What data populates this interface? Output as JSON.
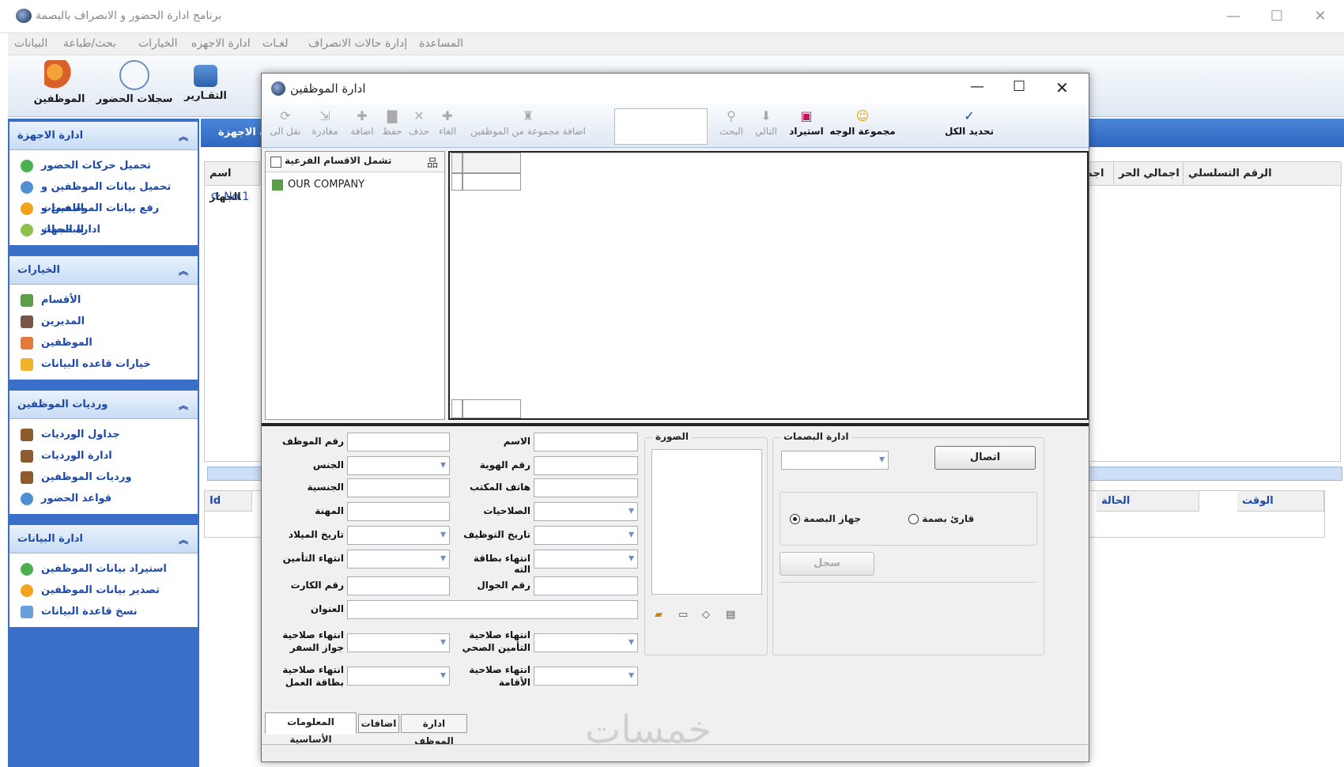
{
  "app": {
    "title": "برنامج ادارة الحضور و الانصراف بالبصمة"
  },
  "menu": [
    "البيانات",
    "بحث/طباعة",
    "الخيارات",
    "ادارة الاجهزه",
    "لغـات",
    "إدارة حالات الانصراف",
    "المساعدة"
  ],
  "toolbar": {
    "employees": "الموظفين",
    "attendance_log": "سجلات الحضور",
    "reports": "التقـارير"
  },
  "sidebar": {
    "devices": {
      "title": "ادارة الاجهزة",
      "items": [
        "تحميل حركات الحضور",
        "تحميل بيانات الموظفين و البصمات",
        "رفع بيانات الموظفين و البصمات",
        "ادارة الجهاز"
      ]
    },
    "options": {
      "title": "الخيارات",
      "items": [
        "الأقسام",
        "المديرين",
        "الموظفين",
        "خيارات قاعده البيانات"
      ]
    },
    "shifts": {
      "title": "ورديات الموظفين",
      "items": [
        "جداول الورديات",
        "ادارة الورديات",
        "ورديات الموظفين",
        "قواعد الحضور"
      ]
    },
    "data": {
      "title": "ادارة البيانات",
      "items": [
        "استيراد بيانات الموظفين",
        "تصدير بيانات الموظفين",
        "نسخ قاعدة البيانات"
      ]
    }
  },
  "background": {
    "header_label": "ة الاجهزة",
    "grid_cols": [
      "اسم الجهاز",
      "اجمالي الحر",
      "اجمالي",
      "الرقم التسلسلي"
    ],
    "device_name": "No.1",
    "grid2_cols": [
      "Id",
      "الحالة",
      "الوقت"
    ]
  },
  "dialog": {
    "title": "ادارة الموظفين",
    "tools": [
      "نقل الى",
      "مغادرة",
      "اضافة",
      "حفظ",
      "حذف",
      "الغاء",
      "اضافة مجموعة من الموظفين",
      "البحث",
      "التالي",
      "استيراد",
      "مجموعة الوجه",
      "تحديد الكل"
    ],
    "tree": {
      "include_sub": "تشمل الاقسام الفرعية",
      "root": "OUR COMPANY"
    },
    "form": {
      "emp_no": "رقم الموظف",
      "name": "الاسم",
      "gender": "الجنس",
      "id_no": "رقم الهوية",
      "nationality": "الجنسية",
      "office_phone": "هاتف المكتب",
      "profession": "المهنة",
      "permissions": "الصلاحيات",
      "birth_date": "تاريخ الميلاد",
      "hire_date": "تاريخ التوظيف",
      "insurance_end": "انتهاء التأمين",
      "card_end": "انتهاء بطاقة الته",
      "card_no": "رقم الكارت",
      "mobile": "رقم الجوال",
      "address": "العنوان",
      "passport_end": "انتهاء صلاحية جواز السفر",
      "health_ins_end": "انتهاء صلاحية التأمين الصحي",
      "work_card_end": "انتهاء صلاحية بطاقة العمل",
      "residence_end": "انتهاء صلاحية الأقامة"
    },
    "photo": "الصورة",
    "fingerprint": {
      "title": "ادارة البصمات",
      "connect": "اتصال",
      "device": "جهاز البصمة",
      "reader": "قارئ بصمة",
      "register": "سجل"
    },
    "tabs": [
      "المعلومات الأساسية",
      "اضافات",
      "ادارة الموظف"
    ]
  },
  "watermark": "خمسات"
}
